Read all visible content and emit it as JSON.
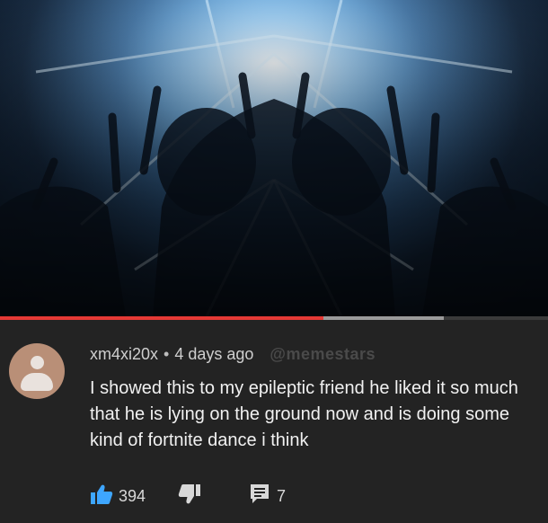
{
  "comment": {
    "author": "xm4xi20x",
    "separator": "•",
    "timestamp": "4 days ago",
    "watermark": "@memestars",
    "text": "I showed this to my epileptic friend he liked it so much that he is lying on the ground now and is doing some kind of fortnite dance i think",
    "like_count": "394",
    "reply_count": "7"
  },
  "icons": {
    "avatar": "default-avatar-icon",
    "like": "thumbs-up-icon",
    "dislike": "thumbs-down-icon",
    "replies": "comment-icon"
  },
  "video": {
    "progress_fraction": 0.59,
    "buffered_fraction": 0.81
  },
  "colors": {
    "like_active": "#3ea6ff",
    "progress": "#e53935",
    "background": "#232323"
  }
}
